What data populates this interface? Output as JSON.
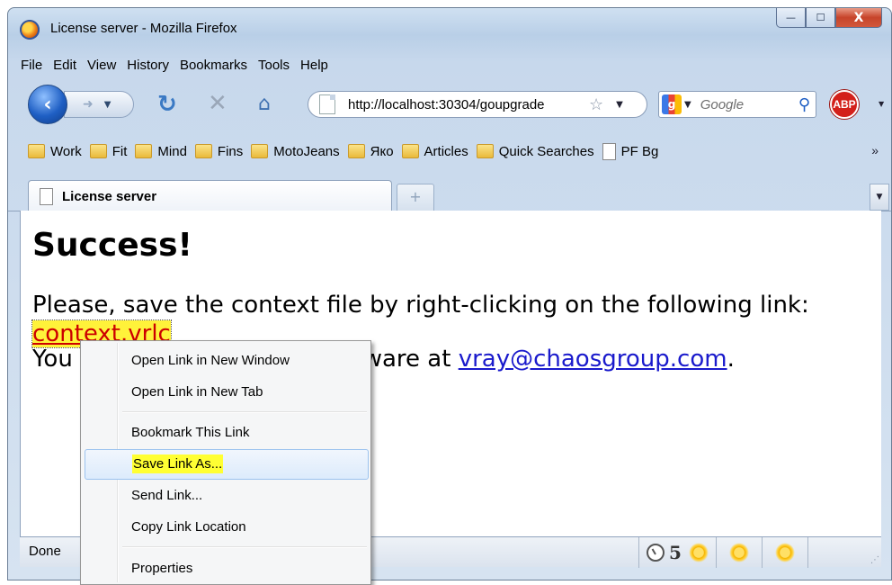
{
  "window": {
    "title": "License server - Mozilla Firefox",
    "controls": {
      "minimize": "—",
      "maximize": "☐",
      "close": "X"
    }
  },
  "menubar": [
    "File",
    "Edit",
    "View",
    "History",
    "Bookmarks",
    "Tools",
    "Help"
  ],
  "navbar": {
    "url": "http://localhost:30304/goupgrade",
    "search_placeholder": "Google",
    "abp_label": "ABP"
  },
  "bookmarks": [
    {
      "label": "Work",
      "icon": "folder-icon"
    },
    {
      "label": "Fit",
      "icon": "folder-icon"
    },
    {
      "label": "Mind",
      "icon": "folder-icon"
    },
    {
      "label": "Fins",
      "icon": "folder-icon"
    },
    {
      "label": "MotoJeans",
      "icon": "folder-icon"
    },
    {
      "label": "Яко",
      "icon": "folder-icon"
    },
    {
      "label": "Articles",
      "icon": "folder-icon"
    },
    {
      "label": "Quick Searches",
      "icon": "folder-icon"
    },
    {
      "label": "PF Bg",
      "icon": "page-icon"
    }
  ],
  "bookmarks_more": "»",
  "tabs": [
    {
      "label": "License server",
      "active": true
    }
  ],
  "newtab_symbol": "+",
  "page": {
    "heading": "Success!",
    "line1": "Please, save the context file by right-clicking on the following link:",
    "link_text": "context.vrlc",
    "line3_prefix": "You",
    "line3_mid": "ftware at ",
    "email": "vray@chaosgroup.com",
    "line3_suffix": "."
  },
  "status": {
    "text": "Done",
    "counter": "5"
  },
  "context_menu": {
    "items": [
      "Open Link in New Window",
      "Open Link in New Tab",
      "Bookmark This Link",
      "Save Link As...",
      "Send Link...",
      "Copy Link Location",
      "Properties"
    ],
    "highlighted_item": "Save Link As..."
  },
  "colors": {
    "link_red": "#cc0000",
    "link_blue": "#1a1acc",
    "highlight_yellow": "#ffff33"
  }
}
